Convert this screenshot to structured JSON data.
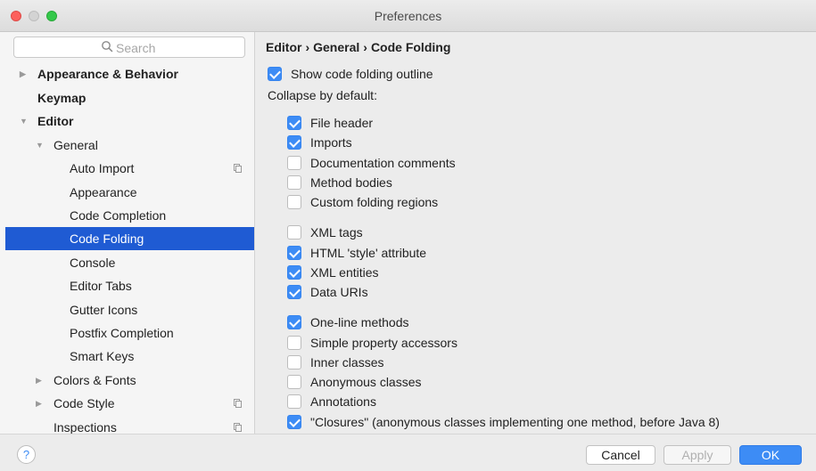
{
  "window": {
    "title": "Preferences"
  },
  "search": {
    "placeholder": "Search"
  },
  "sidebar": {
    "items": [
      {
        "label": "Appearance & Behavior",
        "bold": true,
        "arrow": "right"
      },
      {
        "label": "Keymap",
        "bold": true
      },
      {
        "label": "Editor",
        "bold": true,
        "arrow": "down"
      },
      {
        "label": "General",
        "arrow": "down"
      },
      {
        "label": "Auto Import",
        "copy_icon": true
      },
      {
        "label": "Appearance"
      },
      {
        "label": "Code Completion"
      },
      {
        "label": "Code Folding",
        "selected": true
      },
      {
        "label": "Console"
      },
      {
        "label": "Editor Tabs"
      },
      {
        "label": "Gutter Icons"
      },
      {
        "label": "Postfix Completion"
      },
      {
        "label": "Smart Keys"
      },
      {
        "label": "Colors & Fonts",
        "arrow": "right"
      },
      {
        "label": "Code Style",
        "arrow": "right",
        "copy_icon": true
      },
      {
        "label": "Inspections",
        "copy_icon": true
      }
    ]
  },
  "breadcrumb": {
    "parts": [
      "Editor",
      "General",
      "Code Folding"
    ],
    "separator": "›"
  },
  "main": {
    "show_outline": {
      "label": "Show code folding outline",
      "checked": true
    },
    "collapse_heading": "Collapse by default:",
    "options": [
      {
        "label": "File header",
        "checked": true
      },
      {
        "label": "Imports",
        "checked": true
      },
      {
        "label": "Documentation comments",
        "checked": false
      },
      {
        "label": "Method bodies",
        "checked": false
      },
      {
        "label": "Custom folding regions",
        "checked": false
      },
      {
        "label": "XML tags",
        "checked": false
      },
      {
        "label": "HTML 'style' attribute",
        "checked": true
      },
      {
        "label": "XML entities",
        "checked": true
      },
      {
        "label": "Data URIs",
        "checked": true
      },
      {
        "label": "One-line methods",
        "checked": true
      },
      {
        "label": "Simple property accessors",
        "checked": false
      },
      {
        "label": "Inner classes",
        "checked": false
      },
      {
        "label": "Anonymous classes",
        "checked": false
      },
      {
        "label": "Annotations",
        "checked": false
      },
      {
        "label": "\"Closures\" (anonymous classes implementing one method, before Java 8)",
        "checked": true
      }
    ]
  },
  "footer": {
    "help_label": "?",
    "cancel_label": "Cancel",
    "apply_label": "Apply",
    "ok_label": "OK"
  },
  "colors": {
    "accent": "#3d8cf5",
    "selection": "#1f5bd3"
  }
}
